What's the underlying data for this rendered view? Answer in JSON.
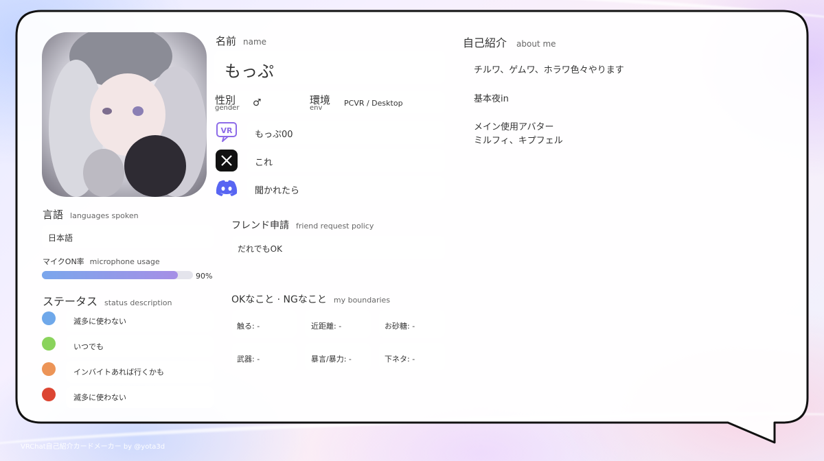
{
  "profile": {
    "name_label": "名前",
    "name_label_en": "name",
    "name": "もっぷ",
    "gender_label": "性別",
    "gender_label_en": "gender",
    "gender": "♂",
    "env_label": "環境",
    "env_label_en": "env",
    "env": "PCVR / Desktop",
    "vrchat_id": "もっぷ00",
    "x_account": "これ",
    "discord": "聞かれたら"
  },
  "languages": {
    "label": "言語",
    "label_en": "languages spoken",
    "value": "日本語"
  },
  "mic": {
    "label": "マイクON率",
    "label_en": "microphone usage",
    "percent_text": "90%",
    "fraction": 0.9
  },
  "status": {
    "label": "ステータス",
    "label_en": "status description",
    "items": [
      {
        "color": "#6fa8ea",
        "text": "滅多に使わない"
      },
      {
        "color": "#8ad35c",
        "text": "いつでも"
      },
      {
        "color": "#ec9457",
        "text": "インバイトあれば行くかも"
      },
      {
        "color": "#dc4532",
        "text": "滅多に使わない"
      }
    ]
  },
  "friend_request": {
    "label": "フレンド申請",
    "label_en": "friend request policy",
    "value": "だれでもOK"
  },
  "boundaries": {
    "label": "OKなこと · NGなこと",
    "label_en": "my boundaries",
    "items": [
      "触る: -",
      "近距離: -",
      "お砂糖: -",
      "武器: -",
      "暴言/暴力: -",
      "下ネタ: -"
    ]
  },
  "about": {
    "label": "自己紹介",
    "label_en": "about me",
    "line1": "チルワ、ゲムワ、ホラワ色々やります",
    "line2": "基本夜in",
    "line3": "メイン使用アバター",
    "line4": "ミルフィ、キプフェル"
  },
  "icons": {
    "vrchat": "vrchat-icon",
    "x": "x-icon",
    "discord": "discord-icon"
  },
  "footer": "VRChat自己紹介カードメーカー by @yota3d"
}
